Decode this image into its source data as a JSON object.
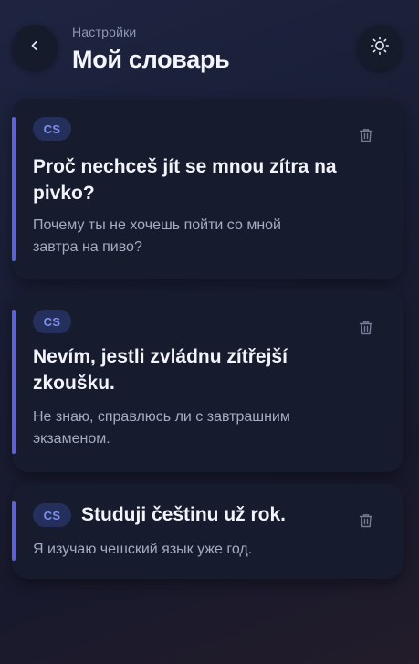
{
  "header": {
    "subtitle": "Настройки",
    "title": "Мой словарь"
  },
  "colors": {
    "accent": "#5b63d6",
    "badge_bg": "#252f5c",
    "badge_text": "#7f8ff0",
    "card_bg": "#161b2d"
  },
  "entries": [
    {
      "lang": "CS",
      "phrase_lines": [
        "Proč nechceš jít se mnou zítra na",
        "pivko?"
      ],
      "translation_lines": [
        "Почему ты не хочешь пойти со мной",
        "завтра на пиво?"
      ]
    },
    {
      "lang": "CS",
      "phrase_lines": [
        "Nevím, jestli zvládnu zítřejší",
        "zkoušku."
      ],
      "translation_lines": [
        "Не знаю, справлюсь ли с завтрашним",
        "экзаменом."
      ]
    },
    {
      "lang": "CS",
      "phrase": "Studuji češtinu už rok.",
      "translation": "Я изучаю чешский язык уже год."
    }
  ],
  "icons": {
    "back": "chevron-left-icon",
    "theme": "sun-icon",
    "delete": "trash-icon"
  }
}
